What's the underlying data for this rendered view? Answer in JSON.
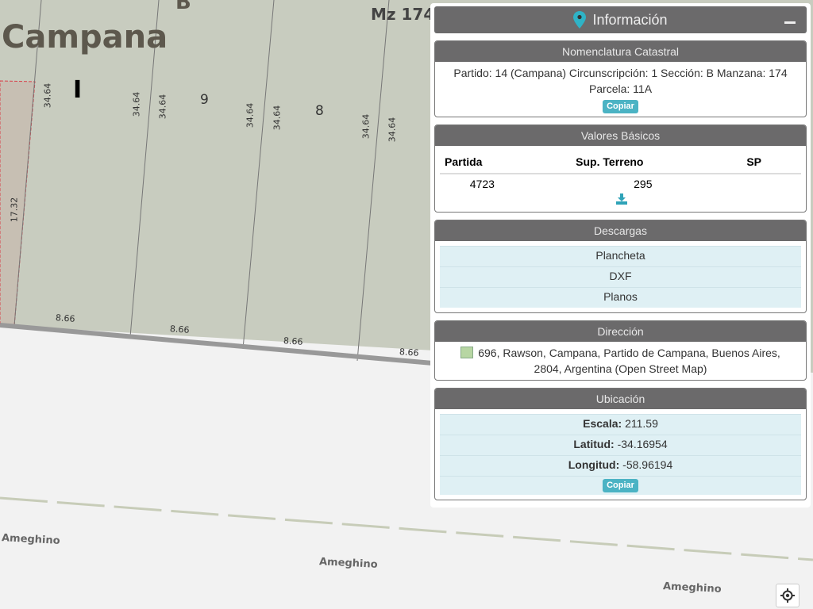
{
  "map": {
    "locality_label": "Campana",
    "section_label": "B",
    "block_label": "Mz 174",
    "circ_label": "I",
    "parcel_labels": [
      "9",
      "8"
    ],
    "depth_label": "34.64",
    "side_label": "17.32",
    "front_label": "8.66",
    "street_label": "Ameghino",
    "colors": {
      "parcel_fill": "#c8ccbf",
      "selected_outline": "#d9404a",
      "background": "#f2f2f2"
    }
  },
  "panel": {
    "title": "Información",
    "icon": "map-marker-icon",
    "accent": "#2fb3c6",
    "nomenclatura": {
      "title": "Nomenclatura Catastral",
      "text": "Partido: 14 (Campana) Circunscripción: 1 Sección: B Manzana: 174 Parcela: 11A",
      "copy_label": "Copiar"
    },
    "valores": {
      "title": "Valores Básicos",
      "headers": [
        "Partida",
        "Sup. Terreno",
        "SP"
      ],
      "row": [
        "4723",
        "295",
        ""
      ],
      "icon": "download-icon"
    },
    "descargas": {
      "title": "Descargas",
      "items": [
        "Plancheta",
        "DXF",
        "Planos"
      ]
    },
    "direccion": {
      "title": "Dirección",
      "text": "696, Rawson, Campana, Partido de Campana, Buenos Aires, 2804, Argentina (Open Street Map)",
      "icon": "osm-icon"
    },
    "ubicacion": {
      "title": "Ubicación",
      "escala_label": "Escala:",
      "escala": "211.59",
      "lat_label": "Latitud:",
      "lat": "-34.16954",
      "lon_label": "Longitud:",
      "lon": "-58.96194",
      "copy_label": "Copiar"
    }
  }
}
